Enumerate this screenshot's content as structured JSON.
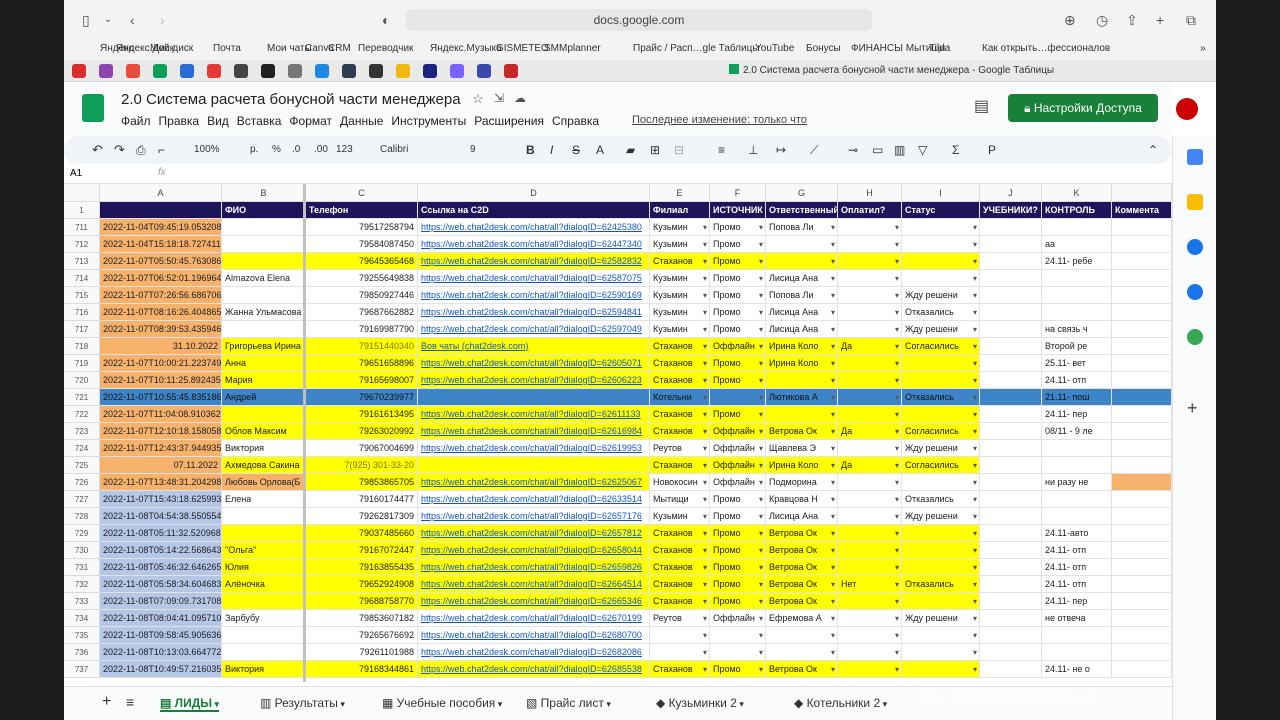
{
  "browser": {
    "url": "docs.google.com",
    "tab_title": "2.0 Система расчета бонусной части менеджера - Google Таблицы"
  },
  "bookmarks": [
    "Яндекс",
    "Яндекс.Диск",
    "Мой диск",
    "Почта",
    "Мои чаты",
    "Canva",
    "CRM",
    "Переводчик",
    "Яндекс.Музыка",
    "GISMETEO",
    "SMMplanner",
    "Прайс / Расп…gle Таблицы",
    "YouTube",
    "Бонусы",
    "ФИНАНСЫ Мытищи",
    "Tilda",
    "Как открыть…фессионалов"
  ],
  "doc": {
    "title": "2.0 Система расчета бонусной части менеджера",
    "menus": [
      "Файл",
      "Правка",
      "Вид",
      "Вставка",
      "Формат",
      "Данные",
      "Инструменты",
      "Расширения",
      "Справка"
    ],
    "last_edit": "Последнее изменение: только что",
    "share": "Настройки Доступа"
  },
  "toolbar": {
    "zoom": "100%",
    "currency": "р.",
    "percent": "%",
    "dec_less": ".0",
    "dec_more": ".00",
    "format": "123",
    "font": "Calibri",
    "size": "9",
    "bold": "B",
    "italic": "I",
    "strike": "S",
    "textcolor": "A"
  },
  "formula": {
    "cell": "A1",
    "fx": "fx"
  },
  "cols": [
    "A",
    "B",
    "C",
    "D",
    "E",
    "F",
    "G",
    "H",
    "I",
    "J",
    "K"
  ],
  "headers": [
    "",
    "ФИО",
    "Телефон",
    "Ссылка на C2D",
    "Филиал",
    "ИСТОЧНИК",
    "Ответственный",
    "Оплатил?",
    "Статус",
    "УЧЕБНИКИ?",
    "КОНТРОЛЬ",
    "Коммента"
  ],
  "rows": [
    [
      "711",
      "2022-11-04T09:45:19.0532082",
      "",
      "79517258794",
      "https://web.chat2desk.com/chat/all?dialogID=62425380",
      "Кузьмин",
      "Промо",
      "Попова Ли",
      "",
      "",
      "",
      "",
      ""
    ],
    [
      "712",
      "2022-11-04T15:18:18.7274112",
      "",
      "79584087450",
      "https://web.chat2desk.com/chat/all?dialogID=62447340",
      "Кузьмин",
      "Промо",
      "",
      "",
      "",
      "",
      "аа"
    ],
    [
      "713",
      "2022-11-07T05:50:45.7630862",
      "",
      "79645365468",
      "https://web.chat2desk.com/chat/all?dialogID=62582832",
      "Стаханов",
      "Промо",
      "",
      "",
      "",
      "",
      "24.11- ребе"
    ],
    [
      "714",
      "2022-11-07T06:52:01.1969642",
      "Almazova Elena",
      "79255649838",
      "https://web.chat2desk.com/chat/all?dialogID=62587075",
      "Кузьмин",
      "Промо",
      "Лисица Ана",
      "",
      "",
      "",
      ""
    ],
    [
      "715",
      "2022-11-07T07:26:56.6867062",
      "",
      "79850927446",
      "https://web.chat2desk.com/chat/all?dialogID=62590169",
      "Кузьмин",
      "Промо",
      "Попова Ли",
      "",
      "Жду решени",
      "",
      ""
    ],
    [
      "716",
      "2022-11-07T08:16:26.4048652",
      "Жанна Ульмасова",
      "79687662882",
      "https://web.chat2desk.com/chat/all?dialogID=62594841",
      "Кузьмин",
      "Промо",
      "Лисица Ана",
      "",
      "Отказались",
      "",
      ""
    ],
    [
      "717",
      "2022-11-07T08:39:53.4359462",
      "",
      "79169987790",
      "https://web.chat2desk.com/chat/all?dialogID=62597049",
      "Кузьмин",
      "Промо",
      "Лисица Ана",
      "",
      "Жду решени",
      "",
      "на связь ч"
    ],
    [
      "718",
      "31.10.2022",
      "Григорьева Ирина",
      "79151440340",
      "Вов чаты (chat2desk.com)",
      "Стаханов",
      "Оффлайн",
      "Ирина Коло",
      "Да",
      "Согласились",
      "",
      "Второй ре"
    ],
    [
      "719",
      "2022-11-07T10:00:21.2237492",
      "Анна",
      "79651658896",
      "https://web.chat2desk.com/chat/all?dialogID=62605071",
      "Стаханов",
      "Промо",
      "Ирина Коло",
      "",
      "",
      "",
      "25.11- вет"
    ],
    [
      "720",
      "2022-11-07T10:11:25.8924352",
      "Мария",
      "79165698007",
      "https://web.chat2desk.com/chat/all?dialogID=62606223",
      "Стаханов",
      "Промо",
      "",
      "",
      "",
      "",
      "24.11- отп"
    ],
    [
      "721",
      "2022-11-07T10:55:45.8351862",
      "Андрей",
      "79670239977",
      "",
      "Котельни",
      "",
      "Лютикова А",
      "",
      "Отказались",
      "",
      "21.11- пош"
    ],
    [
      "722",
      "2022-11-07T11:04:08.9103622",
      "",
      "79161613495",
      "https://web.chat2desk.com/chat/all?dialogID=62611133",
      "Стаханов",
      "Промо",
      "",
      "",
      "",
      "",
      "24.11- пер"
    ],
    [
      "723",
      "2022-11-07T12:10:18.1580582",
      "Облов Максим",
      "79263020992",
      "https://web.chat2desk.com/chat/all?dialogID=62616984",
      "Стаханов",
      "Оффлайн",
      "Ветрова Ок",
      "Да",
      "Согласились",
      "",
      "08/11 - 9 ле"
    ],
    [
      "724",
      "2022-11-07T12:43:37.9449352",
      "Виктория",
      "79067004699",
      "https://web.chat2desk.com/chat/all?dialogID=62619953",
      "Реутов",
      "Оффлайн",
      "Щавлева Э",
      "",
      "Жду решени",
      "",
      ""
    ],
    [
      "725",
      "07.11.2022",
      "Ахмедова Сакина",
      "7(925) 301-33-20",
      "",
      "Стаханов",
      "Оффлайн",
      "Ирина Коло",
      "Да",
      "Согласились",
      "",
      ""
    ],
    [
      "726",
      "2022-11-07T13:48:31.2042982",
      "Любовь Орлова(Б",
      "79853865705",
      "https://web.chat2desk.com/chat/all?dialogID=62625067",
      "Новокосин",
      "Оффлайн",
      "Подморина",
      "",
      "",
      "",
      "ни разу не"
    ],
    [
      "727",
      "2022-11-07T15:43:18.6259932",
      "Елена",
      "79160174477",
      "https://web.chat2desk.com/chat/all?dialogID=62633514",
      "Мытищи",
      "Промо",
      "Кравцова Н",
      "",
      "Отказались",
      "",
      ""
    ],
    [
      "728",
      "2022-11-08T04:54:38.5505542",
      "",
      "79262817309",
      "https://web.chat2desk.com/chat/all?dialogID=62657176",
      "Кузьмин",
      "Промо",
      "Лисица Ана",
      "",
      "Жду решени",
      "",
      ""
    ],
    [
      "729",
      "2022-11-08T05:11:32.5209682",
      "",
      "79037485660",
      "https://web.chat2desk.com/chat/all?dialogID=62657812",
      "Стаханов",
      "Промо",
      "Ветрова Ок",
      "",
      "",
      "",
      "24.11-авто"
    ],
    [
      "730",
      "2022-11-08T05:14:22.5686432",
      "\"Ольга\"",
      "79167072447",
      "https://web.chat2desk.com/chat/all?dialogID=62658044",
      "Стаханов",
      "Промо",
      "Ветрова Ок",
      "",
      "",
      "",
      "24.11- отп"
    ],
    [
      "731",
      "2022-11-08T05:46:32.6462652",
      "Юлия",
      "79163855435",
      "https://web.chat2desk.com/chat/all?dialogID=62659826",
      "Стаханов",
      "Промо",
      "Ветрова Ок",
      "",
      "",
      "",
      "24.11- отп"
    ],
    [
      "732",
      "2022-11-08T05:58:34.6046832",
      "Алёночка",
      "79652924908",
      "https://web.chat2desk.com/chat/all?dialogID=62664514",
      "Стаханов",
      "Промо",
      "Ветрова Ок",
      "Нет",
      "Отказались",
      "",
      "24.11- отп"
    ],
    [
      "733",
      "2022-11-08T07:09:09.7317082",
      "",
      "79688758770",
      "https://web.chat2desk.com/chat/all?dialogID=62665346",
      "Стаханов",
      "Промо",
      "Ветрова Ок",
      "",
      "",
      "",
      "24.11- пер"
    ],
    [
      "734",
      "2022-11-08T08:04:41.0957102",
      "Зарбубу",
      "79853607182",
      "https://web.chat2desk.com/chat/all?dialogID=62670199",
      "Реутов",
      "Оффлайн",
      "Ефремова А",
      "",
      "Жду решени",
      "",
      "не отвеча"
    ],
    [
      "735",
      "2022-11-08T09:58:45.9056362",
      "",
      "79265676692",
      "https://web.chat2desk.com/chat/all?dialogID=62680700",
      "",
      "",
      "",
      "",
      "",
      "",
      ""
    ],
    [
      "736",
      "2022-11-08T10:13:03.6647722",
      "",
      "79261101988",
      "https://web.chat2desk.com/chat/all?dialogID=62682086",
      "",
      "",
      "",
      "",
      "",
      "",
      ""
    ],
    [
      "737",
      "2022-11-08T10:49:57.2160352",
      "Виктория",
      "79168344861",
      "https://web.chat2desk.com/chat/all?dialogID=62685538",
      "Стаханов",
      "Промо",
      "Ветрова Ок",
      "",
      "",
      "",
      "24.11- не о"
    ]
  ],
  "sheets": [
    "ЛИДЫ",
    "Результаты",
    "Учебные пособия",
    "Прайс лист",
    "Кузьминки 2",
    "Котельники 2"
  ],
  "watermark": "DU RECORDER MAC"
}
